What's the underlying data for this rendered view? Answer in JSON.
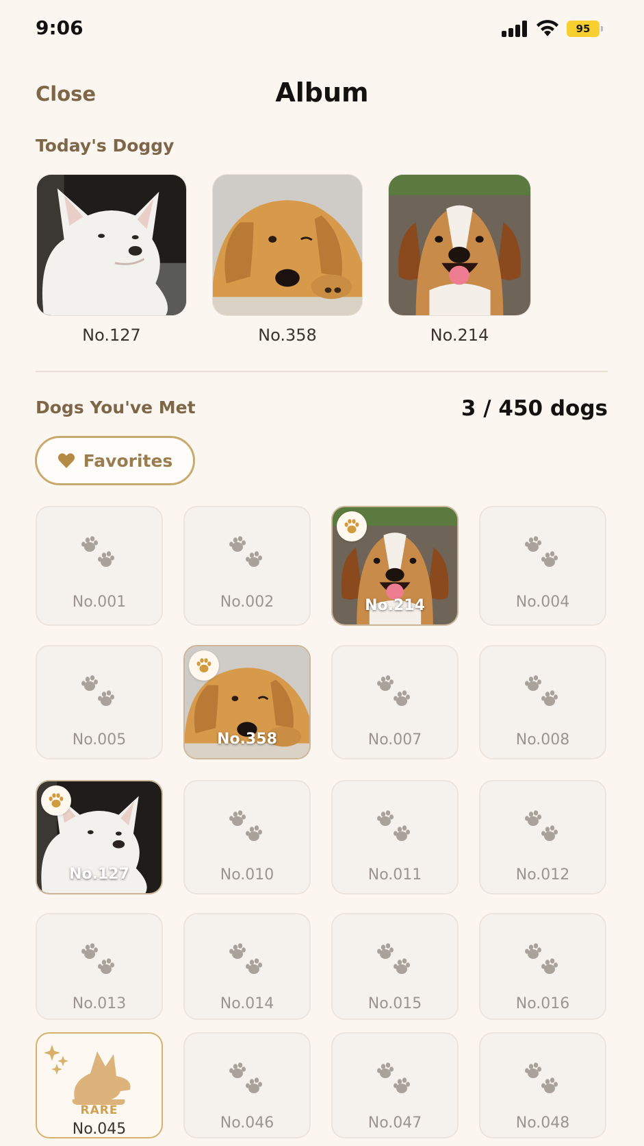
{
  "status_bar": {
    "time": "9:06",
    "battery": "95"
  },
  "nav": {
    "close_label": "Close",
    "title": "Album"
  },
  "today": {
    "heading": "Today's Doggy",
    "dogs": [
      {
        "label": "No.127",
        "breed_icon": "white-shiba-photo"
      },
      {
        "label": "No.358",
        "breed_icon": "golden-retriever-photo"
      },
      {
        "label": "No.214",
        "breed_icon": "beagle-photo"
      }
    ]
  },
  "met": {
    "heading": "Dogs You've Met",
    "count": "3 / 450 dogs",
    "favorites_label": "Favorites"
  },
  "grid": {
    "cells": [
      {
        "label": "No.001",
        "state": "locked"
      },
      {
        "label": "No.002",
        "state": "locked"
      },
      {
        "label": "No.214",
        "state": "unlocked",
        "photo": "beagle"
      },
      {
        "label": "No.004",
        "state": "locked"
      },
      {
        "label": "No.005",
        "state": "locked"
      },
      {
        "label": "No.358",
        "state": "unlocked",
        "photo": "golden"
      },
      {
        "label": "No.007",
        "state": "locked"
      },
      {
        "label": "No.008",
        "state": "locked"
      },
      {
        "label": "No.127",
        "state": "unlocked",
        "photo": "shiba"
      },
      {
        "label": "No.010",
        "state": "locked"
      },
      {
        "label": "No.011",
        "state": "locked"
      },
      {
        "label": "No.012",
        "state": "locked"
      },
      {
        "label": "No.013",
        "state": "locked"
      },
      {
        "label": "No.014",
        "state": "locked"
      },
      {
        "label": "No.015",
        "state": "locked"
      },
      {
        "label": "No.016",
        "state": "locked"
      },
      {
        "label": "No.045",
        "state": "rare",
        "tag": "RARE"
      },
      {
        "label": "No.046",
        "state": "locked"
      },
      {
        "label": "No.047",
        "state": "locked"
      },
      {
        "label": "No.048",
        "state": "locked"
      }
    ]
  },
  "colors": {
    "background": "#fcf6f1",
    "accent": "#c9a96e",
    "heading_brown": "#7d6748",
    "rare_gold": "#d0a052"
  }
}
